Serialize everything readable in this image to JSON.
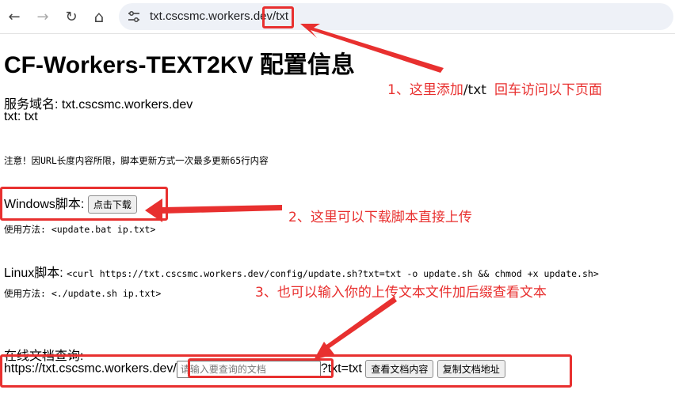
{
  "browser": {
    "back_icon": "←",
    "forward_icon": "→",
    "reload_icon": "↻",
    "home_icon": "⌂",
    "url": "txt.cscsmc.workers.dev/txt"
  },
  "page": {
    "title": "CF-Workers-TEXT2KV 配置信息",
    "domain_line": "服务域名: txt.cscsmc.workers.dev",
    "txt_line": "txt: txt",
    "notice": "注意！因URL长度内容所限，脚本更新方式一次最多更新65行内容",
    "windows_label": "Windows脚本:",
    "download_button": "点击下载",
    "windows_usage": "使用方法: <update.bat  ip.txt>",
    "linux_label": "Linux脚本:",
    "linux_cmd": "<curl  https://txt.cscsmc.workers.dev/config/update.sh?txt=txt  -o  update.sh  &&  chmod  +x  update.sh>",
    "linux_usage": "使用方法: <./update.sh  ip.txt>",
    "query_label": "在线文档查询:",
    "query_prefix": "https://txt.cscsmc.workers.dev/",
    "query_placeholder": "请输入要查询的文档",
    "query_suffix": "?txt=txt",
    "view_button": "查看文档内容",
    "copy_button": "复制文档地址"
  },
  "annotations": {
    "step1_a": "1、这里添加",
    "step1_b": "/txt",
    "step1_c": "回车访问以下页面",
    "step2": "2、这里可以下载脚本直接上传",
    "step3": "3、也可以输入你的上传文本文件加后缀查看文本"
  },
  "colors": {
    "annotation_red": "#e8302f",
    "address_bar_bg": "#eef1f7"
  }
}
